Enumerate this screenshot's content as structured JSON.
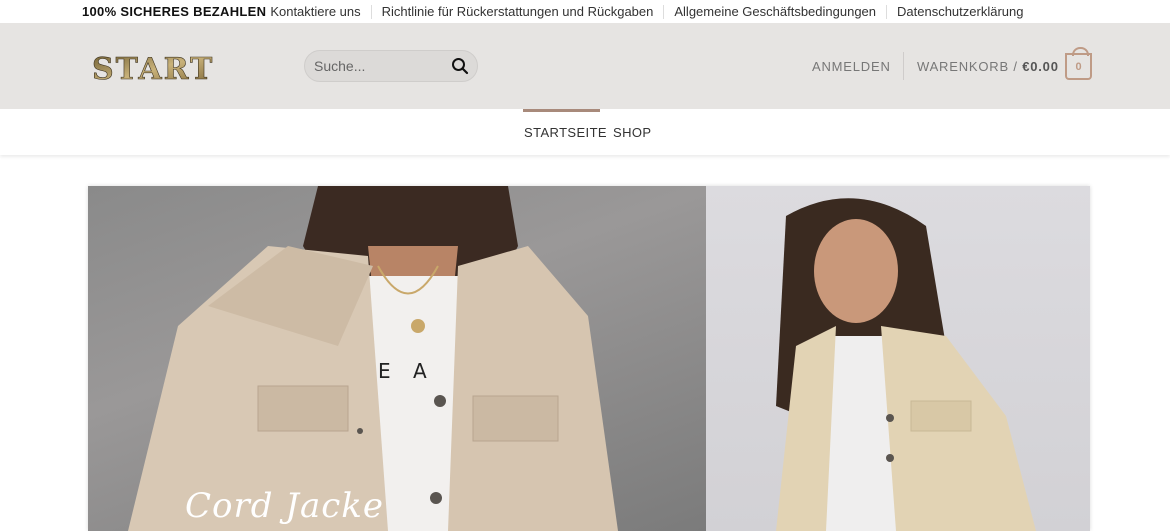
{
  "topbar": {
    "secure_payment": "100% SICHERES BEZAHLEN",
    "links": [
      "Kontaktiere uns",
      "Richtlinie für Rückerstattungen und Rückgaben",
      "Allgemeine Geschäftsbedingungen",
      "Datenschutzerklärung"
    ]
  },
  "header": {
    "logo_text": "START",
    "search_placeholder": "Suche...",
    "login_label": "ANMELDEN",
    "cart_label": "WARENKORB /",
    "cart_total": "€0.00",
    "cart_count": "0"
  },
  "nav": {
    "items": [
      "STARTSEITE",
      "SHOP"
    ],
    "active": "STARTSEITE"
  },
  "banner": {
    "headline": "Cord Jacke",
    "tshirt_letters": "E A"
  },
  "colors": {
    "accent": "#bf9b86",
    "header_bg": "#e6e4e2",
    "nav_indicator": "#a88a7b"
  },
  "icons": {
    "search": "search-icon",
    "cart": "shopping-bag-icon"
  }
}
